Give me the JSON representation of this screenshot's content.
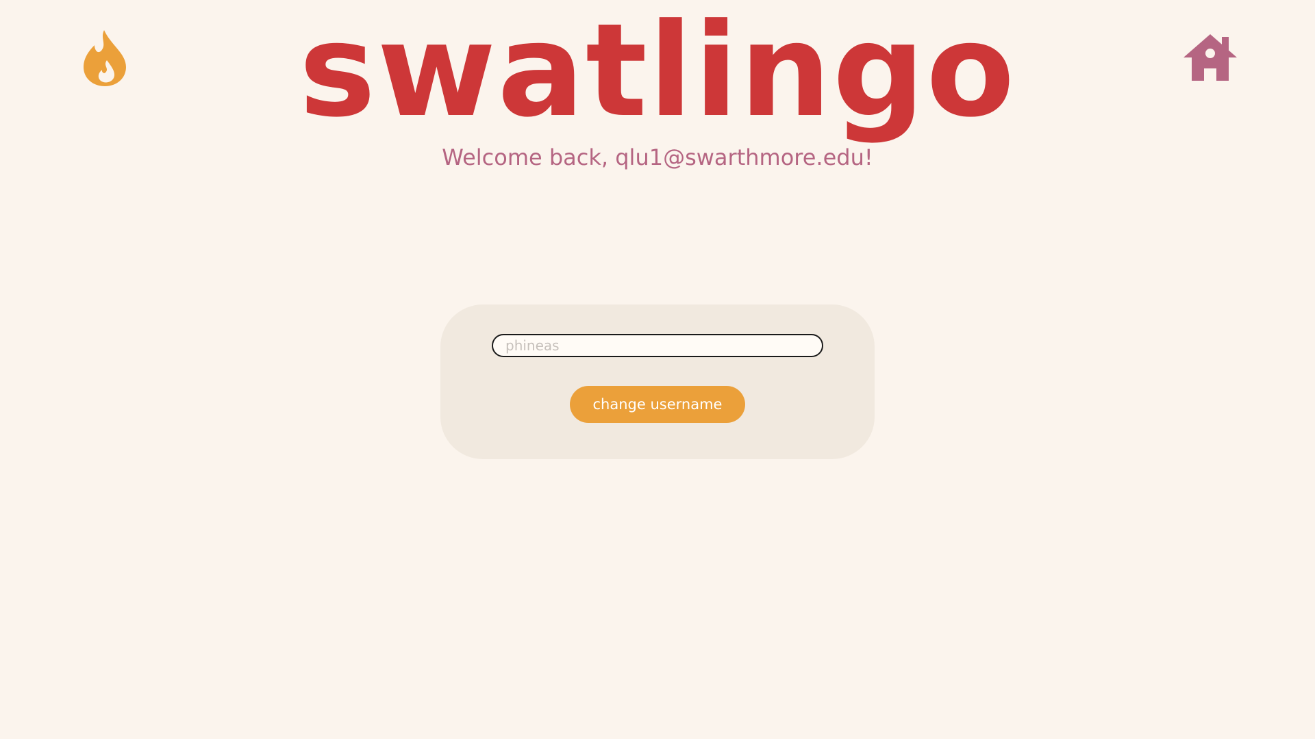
{
  "app": {
    "logo_text": "swatlingo",
    "welcome_text": "Welcome back, qlu1@swarthmore.edu!"
  },
  "nav": {
    "streak_icon": "flame-icon",
    "home_icon": "home-icon"
  },
  "form": {
    "username_placeholder": "phineas",
    "username_value": "",
    "change_button_label": "change username"
  },
  "colors": {
    "background": "#fbf4ed",
    "logo": "#cd3738",
    "welcome_text": "#b56582",
    "card": "#f1e9df",
    "button": "#eba03a",
    "flame": "#eba03a",
    "home": "#b56582"
  }
}
